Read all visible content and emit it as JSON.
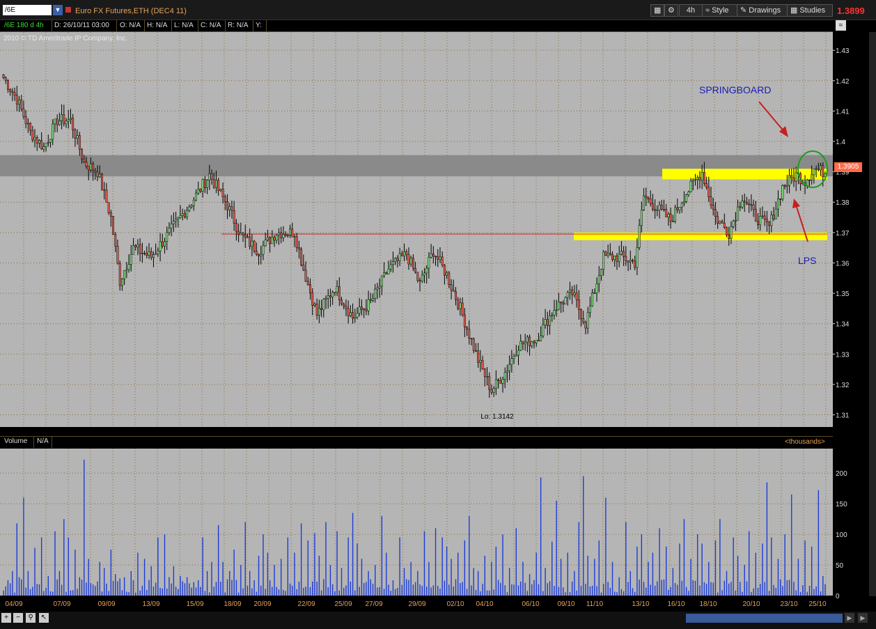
{
  "toolbar": {
    "symbol": "/6E",
    "instrument_title": "Euro FX Futures,ETH (DEC4 11)",
    "timeframe_label": "4h",
    "style_label": "Style",
    "drawings_label": "Drawings",
    "studies_label": "Studies",
    "last_price": "1.3899"
  },
  "infobar": {
    "study": "/6E 180 d 4h",
    "date": "D: 26/10/11 03:00",
    "open": "O: N/A",
    "high": "H: N/A",
    "low": "L: N/A",
    "close": "C: N/A",
    "range": "R: N/A",
    "y": "Y:"
  },
  "copyright": "2010 © TD Ameritrade IP Company, Inc.",
  "volume_header": {
    "label": "Volume",
    "value": "N/A",
    "units": "<thousands>"
  },
  "chart_data": {
    "type": "candlestick",
    "price_axis": {
      "ylim": [
        1.306,
        1.436
      ],
      "ticks": [
        "1.43",
        "1.42",
        "1.41",
        "1.4",
        "1.39",
        "1.38",
        "1.37",
        "1.36",
        "1.35",
        "1.34",
        "1.33",
        "1.32",
        "1.31"
      ]
    },
    "volume_axis": {
      "ylim": [
        0,
        240
      ],
      "ticks": [
        "200",
        "150",
        "100",
        "50",
        "0"
      ]
    },
    "x_labels": [
      "04/09",
      "07/09",
      "09/09",
      "13/09",
      "15/09",
      "18/09",
      "20/09",
      "22/09",
      "25/09",
      "27/09",
      "29/09",
      "02/10",
      "04/10",
      "06/10",
      "09/10",
      "11/10",
      "13/10",
      "16/10",
      "18/10",
      "20/10",
      "23/10",
      "25/10"
    ],
    "price_tag": "1.3905",
    "lo_label": "Lo: 1.3142",
    "annotations": {
      "springboard": "SPRINGBOARD",
      "lps": "LPS"
    },
    "levels": {
      "gray_band": [
        1.3885,
        1.3955
      ],
      "red_line": 1.3695,
      "yellow_upper": [
        1.3875,
        1.391
      ],
      "yellow_lower": [
        1.3675,
        1.37
      ]
    },
    "anchors": [
      [
        0,
        1.421
      ],
      [
        6,
        1.414
      ],
      [
        12,
        1.403
      ],
      [
        18,
        1.398
      ],
      [
        24,
        1.407
      ],
      [
        30,
        1.407
      ],
      [
        36,
        1.393
      ],
      [
        42,
        1.39
      ],
      [
        48,
        1.375
      ],
      [
        52,
        1.354
      ],
      [
        58,
        1.365
      ],
      [
        66,
        1.362
      ],
      [
        76,
        1.372
      ],
      [
        84,
        1.38
      ],
      [
        92,
        1.389
      ],
      [
        100,
        1.379
      ],
      [
        106,
        1.369
      ],
      [
        114,
        1.364
      ],
      [
        122,
        1.37
      ],
      [
        130,
        1.37
      ],
      [
        134,
        1.358
      ],
      [
        140,
        1.343
      ],
      [
        148,
        1.352
      ],
      [
        156,
        1.342
      ],
      [
        164,
        1.347
      ],
      [
        172,
        1.358
      ],
      [
        180,
        1.363
      ],
      [
        186,
        1.353
      ],
      [
        192,
        1.364
      ],
      [
        198,
        1.356
      ],
      [
        204,
        1.345
      ],
      [
        212,
        1.328
      ],
      [
        218,
        1.318
      ],
      [
        224,
        1.324
      ],
      [
        230,
        1.333
      ],
      [
        238,
        1.335
      ],
      [
        246,
        1.345
      ],
      [
        254,
        1.35
      ],
      [
        260,
        1.34
      ],
      [
        268,
        1.362
      ],
      [
        276,
        1.362
      ],
      [
        282,
        1.36
      ],
      [
        286,
        1.382
      ],
      [
        292,
        1.378
      ],
      [
        298,
        1.374
      ],
      [
        304,
        1.382
      ],
      [
        312,
        1.39
      ],
      [
        318,
        1.375
      ],
      [
        324,
        1.37
      ],
      [
        330,
        1.382
      ],
      [
        336,
        1.375
      ],
      [
        342,
        1.372
      ],
      [
        348,
        1.385
      ],
      [
        354,
        1.389
      ],
      [
        358,
        1.387
      ],
      [
        362,
        1.391
      ],
      [
        366,
        1.39
      ]
    ],
    "bars": 368,
    "volume_peaks": [
      [
        1,
        15
      ],
      [
        2,
        25
      ],
      [
        3,
        20
      ],
      [
        4,
        40
      ],
      [
        5,
        5
      ],
      [
        6,
        118
      ],
      [
        7,
        30
      ],
      [
        9,
        160
      ],
      [
        11,
        40
      ],
      [
        14,
        78
      ],
      [
        17,
        95
      ],
      [
        20,
        32
      ],
      [
        23,
        105
      ],
      [
        25,
        40
      ],
      [
        27,
        125
      ],
      [
        29,
        95
      ],
      [
        32,
        75
      ],
      [
        34,
        30
      ],
      [
        36,
        222
      ],
      [
        38,
        60
      ],
      [
        40,
        18
      ],
      [
        43,
        55
      ],
      [
        45,
        45
      ],
      [
        48,
        75
      ],
      [
        50,
        35
      ],
      [
        52,
        28
      ],
      [
        54,
        30
      ],
      [
        57,
        40
      ],
      [
        60,
        70
      ],
      [
        63,
        60
      ],
      [
        66,
        48
      ],
      [
        69,
        95
      ],
      [
        72,
        100
      ],
      [
        74,
        30
      ],
      [
        76,
        48
      ],
      [
        79,
        32
      ],
      [
        82,
        30
      ],
      [
        85,
        22
      ],
      [
        87,
        25
      ],
      [
        89,
        95
      ],
      [
        91,
        40
      ],
      [
        93,
        55
      ],
      [
        96,
        115
      ],
      [
        98,
        55
      ],
      [
        101,
        40
      ],
      [
        103,
        75
      ],
      [
        106,
        50
      ],
      [
        108,
        120
      ],
      [
        110,
        40
      ],
      [
        112,
        25
      ],
      [
        114,
        65
      ],
      [
        116,
        100
      ],
      [
        118,
        70
      ],
      [
        121,
        50
      ],
      [
        124,
        60
      ],
      [
        127,
        95
      ],
      [
        130,
        70
      ],
      [
        133,
        118
      ],
      [
        136,
        90
      ],
      [
        139,
        102
      ],
      [
        141,
        65
      ],
      [
        144,
        120
      ],
      [
        146,
        50
      ],
      [
        149,
        105
      ],
      [
        151,
        45
      ],
      [
        154,
        95
      ],
      [
        156,
        135
      ],
      [
        158,
        85
      ],
      [
        160,
        60
      ],
      [
        163,
        40
      ],
      [
        166,
        50
      ],
      [
        169,
        130
      ],
      [
        171,
        70
      ],
      [
        174,
        25
      ],
      [
        177,
        95
      ],
      [
        179,
        45
      ],
      [
        182,
        55
      ],
      [
        185,
        40
      ],
      [
        188,
        105
      ],
      [
        190,
        55
      ],
      [
        193,
        110
      ],
      [
        196,
        95
      ],
      [
        198,
        80
      ],
      [
        200,
        60
      ],
      [
        203,
        70
      ],
      [
        206,
        90
      ],
      [
        208,
        130
      ],
      [
        210,
        45
      ],
      [
        212,
        40
      ],
      [
        215,
        65
      ],
      [
        218,
        55
      ],
      [
        220,
        80
      ],
      [
        223,
        100
      ],
      [
        226,
        45
      ],
      [
        229,
        110
      ],
      [
        232,
        55
      ],
      [
        235,
        35
      ],
      [
        238,
        70
      ],
      [
        240,
        193
      ],
      [
        242,
        45
      ],
      [
        245,
        88
      ],
      [
        247,
        155
      ],
      [
        249,
        60
      ],
      [
        252,
        70
      ],
      [
        255,
        40
      ],
      [
        257,
        120
      ],
      [
        259,
        195
      ],
      [
        261,
        65
      ],
      [
        264,
        60
      ],
      [
        266,
        90
      ],
      [
        269,
        160
      ],
      [
        272,
        55
      ],
      [
        275,
        30
      ],
      [
        278,
        120
      ],
      [
        280,
        40
      ],
      [
        283,
        80
      ],
      [
        285,
        100
      ],
      [
        288,
        55
      ],
      [
        290,
        70
      ],
      [
        293,
        110
      ],
      [
        296,
        80
      ],
      [
        299,
        45
      ],
      [
        302,
        85
      ],
      [
        304,
        125
      ],
      [
        307,
        60
      ],
      [
        310,
        100
      ],
      [
        312,
        85
      ],
      [
        315,
        55
      ],
      [
        318,
        90
      ],
      [
        320,
        125
      ],
      [
        323,
        40
      ],
      [
        326,
        95
      ],
      [
        328,
        65
      ],
      [
        331,
        50
      ],
      [
        333,
        105
      ],
      [
        336,
        70
      ],
      [
        339,
        85
      ],
      [
        341,
        185
      ],
      [
        343,
        95
      ],
      [
        346,
        60
      ],
      [
        349,
        100
      ],
      [
        352,
        165
      ],
      [
        355,
        60
      ],
      [
        358,
        90
      ],
      [
        361,
        80
      ],
      [
        364,
        172
      ],
      [
        366,
        32
      ]
    ]
  }
}
